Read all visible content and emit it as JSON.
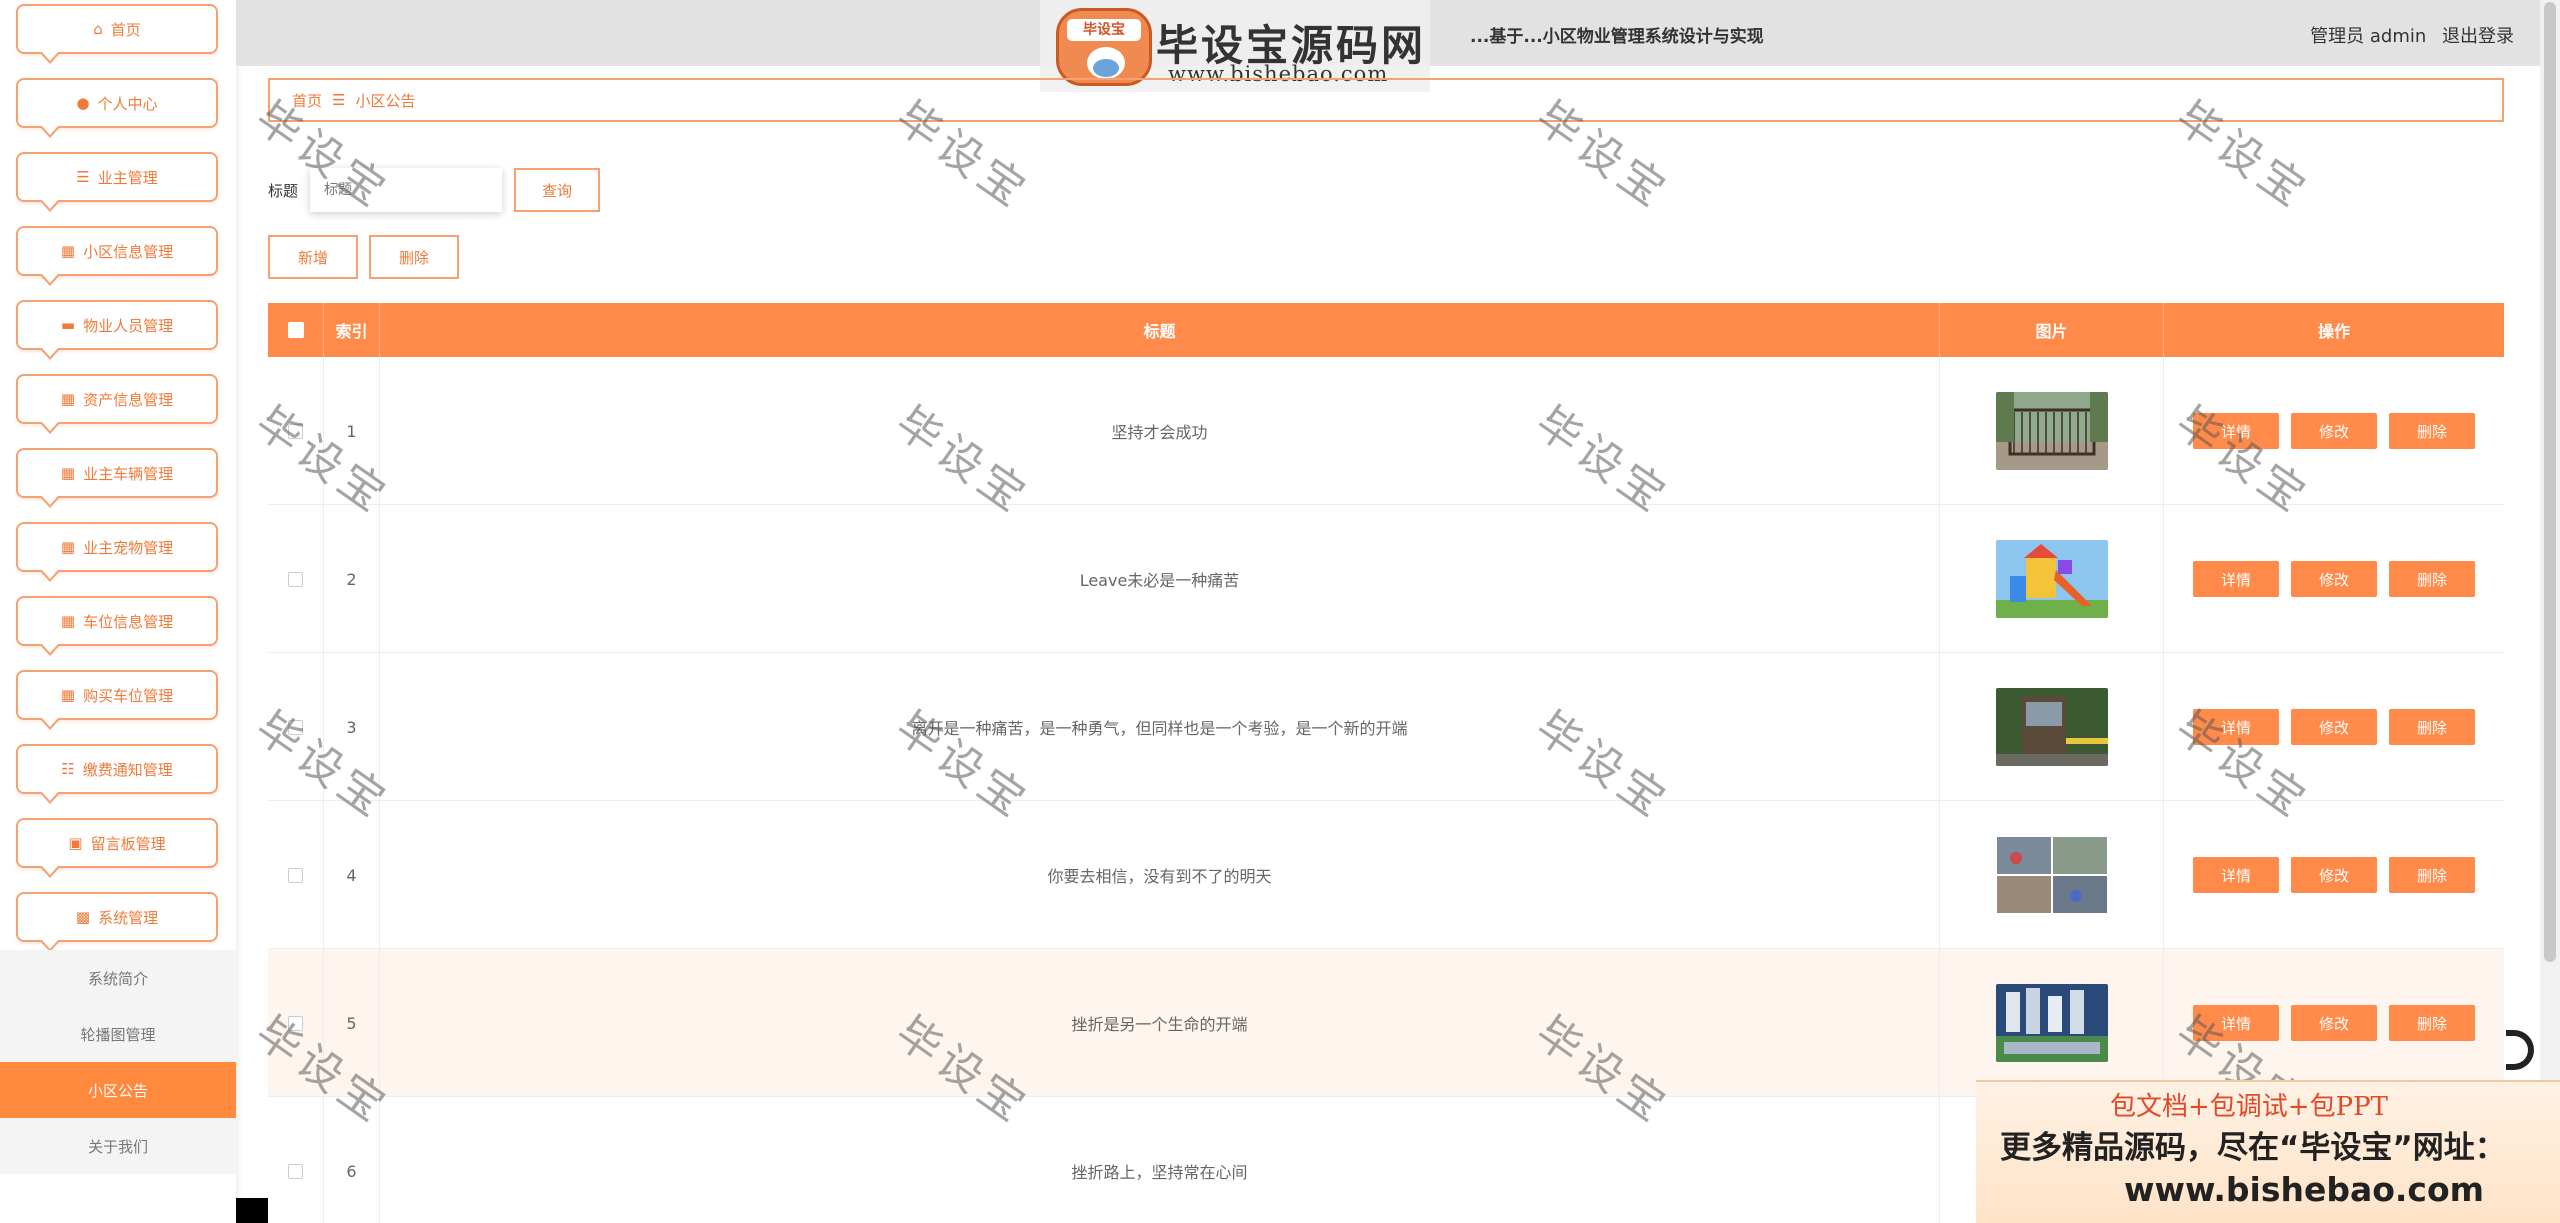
{
  "header": {
    "system_title": "...基于...小区物业管理系统设计与实现",
    "user_label": "管理员 admin",
    "logout": "退出登录",
    "logo_text": "毕设宝源码网",
    "logo_tag": "毕设宝",
    "logo_url": "www.bishebao.com"
  },
  "sidebar": {
    "items": [
      {
        "label": "首页",
        "icon": "home-icon"
      },
      {
        "label": "个人中心",
        "icon": "user-icon"
      },
      {
        "label": "业主管理",
        "icon": "list-icon"
      },
      {
        "label": "小区信息管理",
        "icon": "grid-icon"
      },
      {
        "label": "物业人员管理",
        "icon": "printer-icon"
      },
      {
        "label": "资产信息管理",
        "icon": "grid-icon"
      },
      {
        "label": "业主车辆管理",
        "icon": "grid-icon"
      },
      {
        "label": "业主宠物管理",
        "icon": "grid-icon"
      },
      {
        "label": "车位信息管理",
        "icon": "grid-icon"
      },
      {
        "label": "购买车位管理",
        "icon": "apps-icon"
      },
      {
        "label": "缴费通知管理",
        "icon": "sliders-icon"
      },
      {
        "label": "留言板管理",
        "icon": "briefcase-icon"
      },
      {
        "label": "系统管理",
        "icon": "ticket-icon"
      }
    ],
    "submenu": [
      "系统简介",
      "轮播图管理",
      "小区公告",
      "关于我们"
    ],
    "active_sub": "小区公告"
  },
  "breadcrumb": {
    "home": "首页",
    "separator": "☰",
    "current": "小区公告"
  },
  "search": {
    "label": "标题",
    "placeholder": "标题",
    "query_button": "查询"
  },
  "actions": {
    "add": "新增",
    "delete": "删除"
  },
  "table": {
    "headers": {
      "index": "索引",
      "title": "标题",
      "image": "图片",
      "ops": "操作"
    },
    "rows": [
      {
        "index": "1",
        "title": "坚持才会成功",
        "img": "gate"
      },
      {
        "index": "2",
        "title": "Leave未必是一种痛苦",
        "img": "playground"
      },
      {
        "index": "3",
        "title": "离开是一种痛苦，是一种勇气，但同样也是一个考验，是一个新的开端",
        "img": "booth"
      },
      {
        "index": "4",
        "title": "你要去相信，没有到不了的明天",
        "img": "collage"
      },
      {
        "index": "5",
        "title": "挫折是另一个生命的开端",
        "img": "aerial"
      },
      {
        "index": "6",
        "title": "挫折路上，坚持常在心间",
        "img": ""
      }
    ],
    "row_buttons": {
      "detail": "详情",
      "edit": "修改",
      "delete": "删除"
    }
  },
  "watermark": "毕设宝",
  "ad": {
    "line1": "包文档+包调试+包PPT",
    "line2": "更多精品源码，尽在“毕设宝”网址：",
    "line3": "www.bishebao.com"
  },
  "colors": {
    "accent": "#ff8a4a",
    "border": "#f8a070",
    "text_accent": "#f07a3a"
  }
}
